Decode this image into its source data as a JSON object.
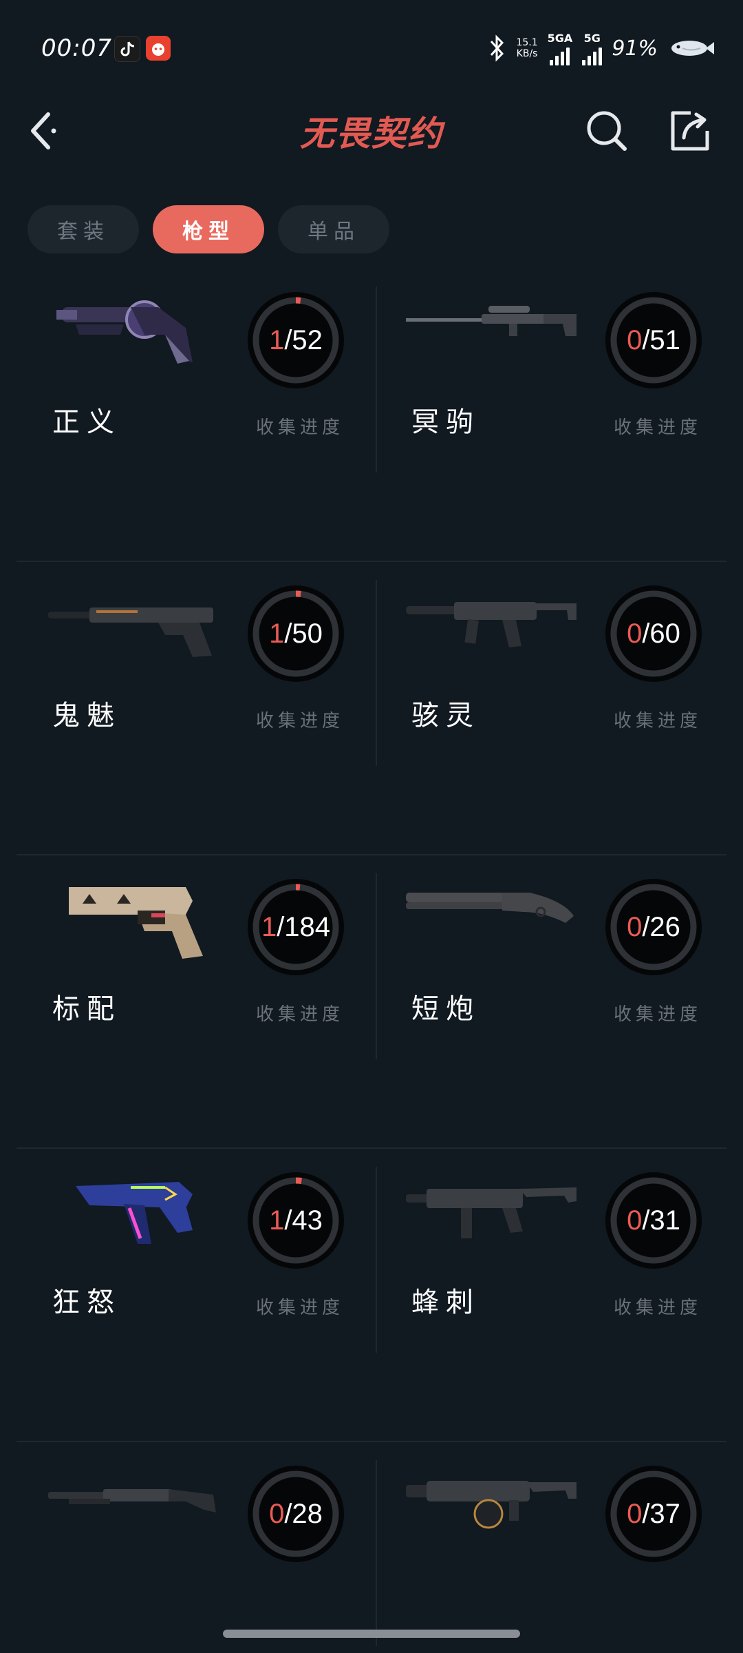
{
  "status_bar": {
    "time": "00:07",
    "net_speed_value": "15.1",
    "net_speed_unit": "KB/s",
    "sim1": "5GA",
    "sim2": "5G",
    "battery": "91%"
  },
  "header": {
    "title": "无畏契约"
  },
  "tabs": [
    {
      "label": "套装",
      "active": false
    },
    {
      "label": "枪型",
      "active": true
    },
    {
      "label": "单品",
      "active": false
    }
  ],
  "progress_label": "收集进度",
  "weapons": [
    {
      "name": "正义",
      "owned": "1",
      "total": "/52",
      "fraction": 0.019,
      "icon": "revolver-skin"
    },
    {
      "name": "冥驹",
      "owned": "0",
      "total": "/51",
      "fraction": 0,
      "icon": "sniper-rifle"
    },
    {
      "name": "鬼魅",
      "owned": "1",
      "total": "/50",
      "fraction": 0.02,
      "icon": "silenced-pistol"
    },
    {
      "name": "骇灵",
      "owned": "0",
      "total": "/60",
      "fraction": 0,
      "icon": "smg-silenced"
    },
    {
      "name": "标配",
      "owned": "1",
      "total": "/184",
      "fraction": 0.005,
      "icon": "classic-pistol"
    },
    {
      "name": "短炮",
      "owned": "0",
      "total": "/26",
      "fraction": 0,
      "icon": "sawed-off-shotgun"
    },
    {
      "name": "狂怒",
      "owned": "1",
      "total": "/43",
      "fraction": 0.023,
      "icon": "frenzy-pistol"
    },
    {
      "name": "蜂刺",
      "owned": "0",
      "total": "/31",
      "fraction": 0,
      "icon": "stinger-smg"
    },
    {
      "name": "",
      "owned": "0",
      "total": "/28",
      "fraction": 0,
      "icon": "shotgun"
    },
    {
      "name": "",
      "owned": "0",
      "total": "/37",
      "fraction": 0,
      "icon": "drum-shotgun"
    }
  ],
  "colors": {
    "accent": "#e86a5e",
    "background": "#111921"
  }
}
